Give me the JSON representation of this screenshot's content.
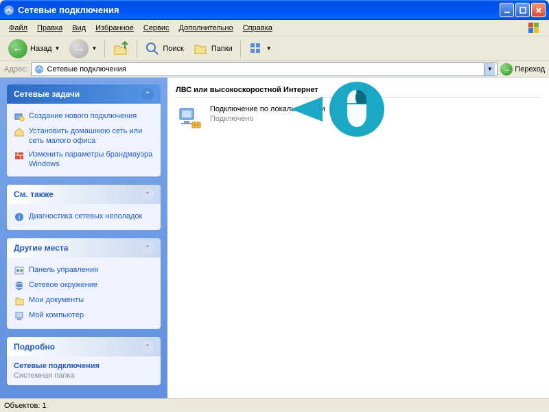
{
  "window": {
    "title": "Сетевые подключения"
  },
  "menu": {
    "file": "Файл",
    "edit": "Правка",
    "view": "Вид",
    "favorites": "Избранное",
    "service": "Сервис",
    "advanced": "Дополнительно",
    "help": "Справка"
  },
  "toolbar": {
    "back": "Назад",
    "search": "Поиск",
    "folders": "Папки"
  },
  "address": {
    "label": "Адрес:",
    "value": "Сетевые подключения",
    "go": "Переход"
  },
  "sidebar": {
    "tasks": {
      "title": "Сетевые задачи",
      "items": [
        "Создание нового подключения",
        "Установить домашнюю сеть или сеть малого офиса",
        "Изменить параметры брандмауэра Windows"
      ]
    },
    "seealso": {
      "title": "См. также",
      "items": [
        "Диагностика сетевых неполадок"
      ]
    },
    "places": {
      "title": "Другие места",
      "items": [
        "Панель управления",
        "Сетевое окружение",
        "Мои документы",
        "Мой компьютер"
      ]
    },
    "details": {
      "title": "Подробно",
      "name": "Сетевые подключения",
      "type": "Системная папка"
    }
  },
  "content": {
    "section": "ЛВС или высокоскоростной Интернет",
    "connection": {
      "name": "Подключение по локальной сети",
      "status": "Подключено"
    }
  },
  "statusbar": {
    "text": "Объектов: 1"
  }
}
